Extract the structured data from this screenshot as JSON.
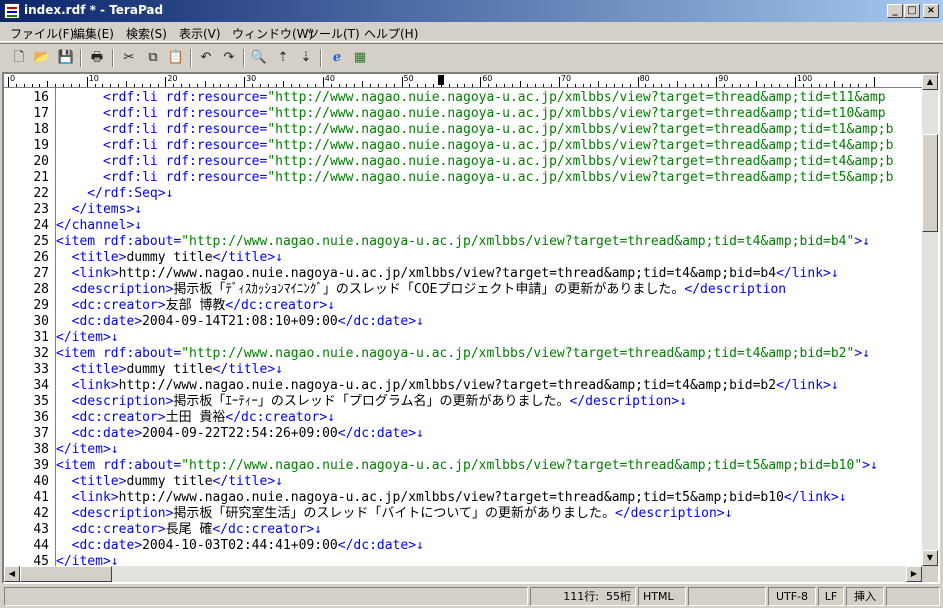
{
  "window": {
    "title": "index.rdf * - TeraPad"
  },
  "window_buttons": [
    "_",
    "□",
    "×"
  ],
  "menu": [
    "ファイル(F)",
    "編集(E)",
    "検索(S)",
    "表示(V)",
    "ウィンドウ(W)",
    "ツール(T)",
    "ヘルプ(H)"
  ],
  "toolbar": [
    {
      "name": "new-file-icon",
      "glyph": "🗋"
    },
    {
      "name": "open-folder-icon",
      "glyph": "📂"
    },
    {
      "name": "save-icon",
      "glyph": "💾"
    },
    {
      "name": "print-icon",
      "glyph": "🖶"
    },
    {
      "name": "cut-icon",
      "glyph": "✂"
    },
    {
      "name": "copy-icon",
      "glyph": "⧉"
    },
    {
      "name": "paste-icon",
      "glyph": "📋"
    },
    {
      "name": "undo-icon",
      "glyph": "↶"
    },
    {
      "name": "redo-icon",
      "glyph": "↷"
    },
    {
      "name": "find-icon",
      "glyph": "🔍"
    },
    {
      "name": "find-next-icon",
      "glyph": "⇡"
    },
    {
      "name": "find-prev-icon",
      "glyph": "⇣"
    },
    {
      "name": "browser-icon",
      "glyph": "ℯ"
    },
    {
      "name": "settings-icon",
      "glyph": "▦"
    }
  ],
  "ruler": {
    "labels": [
      "0",
      "10",
      "20",
      "30",
      "40",
      "50",
      "60",
      "70",
      "80",
      "90",
      "100"
    ],
    "caret_column": 55
  },
  "colors": {
    "text": "#000000",
    "tag": "#0000ff",
    "string": "#008000",
    "newline": "#0000ff"
  },
  "editor": {
    "lines": [
      {
        "n": "16",
        "segs": [
          {
            "t": "      <rdf:li rdf:resource=",
            "c": "tag"
          },
          {
            "t": "\"http://www.nagao.nuie.nagoya-u.ac.jp/xmlbbs/view?target=thread&amp;tid=t11&amp",
            "c": "string"
          }
        ]
      },
      {
        "n": "17",
        "segs": [
          {
            "t": "      <rdf:li rdf:resource=",
            "c": "tag"
          },
          {
            "t": "\"http://www.nagao.nuie.nagoya-u.ac.jp/xmlbbs/view?target=thread&amp;tid=t10&amp",
            "c": "string"
          }
        ]
      },
      {
        "n": "18",
        "segs": [
          {
            "t": "      <rdf:li rdf:resource=",
            "c": "tag"
          },
          {
            "t": "\"http://www.nagao.nuie.nagoya-u.ac.jp/xmlbbs/view?target=thread&amp;tid=t1&amp;b",
            "c": "string"
          }
        ]
      },
      {
        "n": "19",
        "segs": [
          {
            "t": "      <rdf:li rdf:resource=",
            "c": "tag"
          },
          {
            "t": "\"http://www.nagao.nuie.nagoya-u.ac.jp/xmlbbs/view?target=thread&amp;tid=t4&amp;b",
            "c": "string"
          }
        ]
      },
      {
        "n": "20",
        "segs": [
          {
            "t": "      <rdf:li rdf:resource=",
            "c": "tag"
          },
          {
            "t": "\"http://www.nagao.nuie.nagoya-u.ac.jp/xmlbbs/view?target=thread&amp;tid=t4&amp;b",
            "c": "string"
          }
        ]
      },
      {
        "n": "21",
        "segs": [
          {
            "t": "      <rdf:li rdf:resource=",
            "c": "tag"
          },
          {
            "t": "\"http://www.nagao.nuie.nagoya-u.ac.jp/xmlbbs/view?target=thread&amp;tid=t5&amp;b",
            "c": "string"
          }
        ]
      },
      {
        "n": "22",
        "segs": [
          {
            "t": "    </rdf:Seq>",
            "c": "tag"
          },
          {
            "t": "↓",
            "c": "newline"
          }
        ]
      },
      {
        "n": "23",
        "segs": [
          {
            "t": "  </items>",
            "c": "tag"
          },
          {
            "t": "↓",
            "c": "newline"
          }
        ]
      },
      {
        "n": "24",
        "segs": [
          {
            "t": "</channel>",
            "c": "tag"
          },
          {
            "t": "↓",
            "c": "newline"
          }
        ]
      },
      {
        "n": "25",
        "segs": [
          {
            "t": "<item rdf:about=",
            "c": "tag"
          },
          {
            "t": "\"http://www.nagao.nuie.nagoya-u.ac.jp/xmlbbs/view?target=thread&amp;tid=t4&amp;bid=b4\"",
            "c": "string"
          },
          {
            "t": ">",
            "c": "tag"
          },
          {
            "t": "↓",
            "c": "newline"
          }
        ]
      },
      {
        "n": "26",
        "segs": [
          {
            "t": "  <title>",
            "c": "tag"
          },
          {
            "t": "dummy title",
            "c": "text"
          },
          {
            "t": "</title>",
            "c": "tag"
          },
          {
            "t": "↓",
            "c": "newline"
          }
        ]
      },
      {
        "n": "27",
        "segs": [
          {
            "t": "  <link>",
            "c": "tag"
          },
          {
            "t": "http://www.nagao.nuie.nagoya-u.ac.jp/xmlbbs/view?target=thread&amp;tid=t4&amp;bid=b4",
            "c": "text"
          },
          {
            "t": "</link>",
            "c": "tag"
          },
          {
            "t": "↓",
            "c": "newline"
          }
        ]
      },
      {
        "n": "28",
        "segs": [
          {
            "t": "  <description>",
            "c": "tag"
          },
          {
            "t": "掲示板「ﾃﾞｨｽｶｯｼｮﾝﾏｲﾆﾝｸﾞ」のスレッド「COEプロジェクト申請」の更新がありました。",
            "c": "text"
          },
          {
            "t": "</description",
            "c": "tag"
          }
        ]
      },
      {
        "n": "29",
        "segs": [
          {
            "t": "  <dc:creator>",
            "c": "tag"
          },
          {
            "t": "友部 博教",
            "c": "text"
          },
          {
            "t": "</dc:creator>",
            "c": "tag"
          },
          {
            "t": "↓",
            "c": "newline"
          }
        ]
      },
      {
        "n": "30",
        "segs": [
          {
            "t": "  <dc:date>",
            "c": "tag"
          },
          {
            "t": "2004-09-14T21:08:10+09:00",
            "c": "text"
          },
          {
            "t": "</dc:date>",
            "c": "tag"
          },
          {
            "t": "↓",
            "c": "newline"
          }
        ]
      },
      {
        "n": "31",
        "segs": [
          {
            "t": "</item>",
            "c": "tag"
          },
          {
            "t": "↓",
            "c": "newline"
          }
        ]
      },
      {
        "n": "32",
        "segs": [
          {
            "t": "<item rdf:about=",
            "c": "tag"
          },
          {
            "t": "\"http://www.nagao.nuie.nagoya-u.ac.jp/xmlbbs/view?target=thread&amp;tid=t4&amp;bid=b2\"",
            "c": "string"
          },
          {
            "t": ">",
            "c": "tag"
          },
          {
            "t": "↓",
            "c": "newline"
          }
        ]
      },
      {
        "n": "33",
        "segs": [
          {
            "t": "  <title>",
            "c": "tag"
          },
          {
            "t": "dummy title",
            "c": "text"
          },
          {
            "t": "</title>",
            "c": "tag"
          },
          {
            "t": "↓",
            "c": "newline"
          }
        ]
      },
      {
        "n": "34",
        "segs": [
          {
            "t": "  <link>",
            "c": "tag"
          },
          {
            "t": "http://www.nagao.nuie.nagoya-u.ac.jp/xmlbbs/view?target=thread&amp;tid=t4&amp;bid=b2",
            "c": "text"
          },
          {
            "t": "</link>",
            "c": "tag"
          },
          {
            "t": "↓",
            "c": "newline"
          }
        ]
      },
      {
        "n": "35",
        "segs": [
          {
            "t": "  <description>",
            "c": "tag"
          },
          {
            "t": "掲示板「ｴｰﾃｨｰ」のスレッド「プログラム名」の更新がありました。",
            "c": "text"
          },
          {
            "t": "</description>",
            "c": "tag"
          },
          {
            "t": "↓",
            "c": "newline"
          }
        ]
      },
      {
        "n": "36",
        "segs": [
          {
            "t": "  <dc:creator>",
            "c": "tag"
          },
          {
            "t": "土田 貴裕",
            "c": "text"
          },
          {
            "t": "</dc:creator>",
            "c": "tag"
          },
          {
            "t": "↓",
            "c": "newline"
          }
        ]
      },
      {
        "n": "37",
        "segs": [
          {
            "t": "  <dc:date>",
            "c": "tag"
          },
          {
            "t": "2004-09-22T22:54:26+09:00",
            "c": "text"
          },
          {
            "t": "</dc:date>",
            "c": "tag"
          },
          {
            "t": "↓",
            "c": "newline"
          }
        ]
      },
      {
        "n": "38",
        "segs": [
          {
            "t": "</item>",
            "c": "tag"
          },
          {
            "t": "↓",
            "c": "newline"
          }
        ]
      },
      {
        "n": "39",
        "segs": [
          {
            "t": "<item rdf:about=",
            "c": "tag"
          },
          {
            "t": "\"http://www.nagao.nuie.nagoya-u.ac.jp/xmlbbs/view?target=thread&amp;tid=t5&amp;bid=b10\"",
            "c": "string"
          },
          {
            "t": ">",
            "c": "tag"
          },
          {
            "t": "↓",
            "c": "newline"
          }
        ]
      },
      {
        "n": "40",
        "segs": [
          {
            "t": "  <title>",
            "c": "tag"
          },
          {
            "t": "dummy title",
            "c": "text"
          },
          {
            "t": "</title>",
            "c": "tag"
          },
          {
            "t": "↓",
            "c": "newline"
          }
        ]
      },
      {
        "n": "41",
        "segs": [
          {
            "t": "  <link>",
            "c": "tag"
          },
          {
            "t": "http://www.nagao.nuie.nagoya-u.ac.jp/xmlbbs/view?target=thread&amp;tid=t5&amp;bid=b10",
            "c": "text"
          },
          {
            "t": "</link>",
            "c": "tag"
          },
          {
            "t": "↓",
            "c": "newline"
          }
        ]
      },
      {
        "n": "42",
        "segs": [
          {
            "t": "  <description>",
            "c": "tag"
          },
          {
            "t": "掲示板「研究室生活」のスレッド「バイトについて」の更新がありました。",
            "c": "text"
          },
          {
            "t": "</description>",
            "c": "tag"
          },
          {
            "t": "↓",
            "c": "newline"
          }
        ]
      },
      {
        "n": "43",
        "segs": [
          {
            "t": "  <dc:creator>",
            "c": "tag"
          },
          {
            "t": "長尾 確",
            "c": "text"
          },
          {
            "t": "</dc:creator>",
            "c": "tag"
          },
          {
            "t": "↓",
            "c": "newline"
          }
        ]
      },
      {
        "n": "44",
        "segs": [
          {
            "t": "  <dc:date>",
            "c": "tag"
          },
          {
            "t": "2004-10-03T02:44:41+09:00",
            "c": "text"
          },
          {
            "t": "</dc:date>",
            "c": "tag"
          },
          {
            "t": "↓",
            "c": "newline"
          }
        ]
      },
      {
        "n": "45",
        "segs": [
          {
            "t": "</item>",
            "c": "tag"
          },
          {
            "t": "↓",
            "c": "newline"
          }
        ]
      }
    ]
  },
  "status": {
    "position": "111行:  55桁",
    "mode": "HTML",
    "encoding": "UTF-8",
    "newline": "LF",
    "insert": "挿入"
  }
}
